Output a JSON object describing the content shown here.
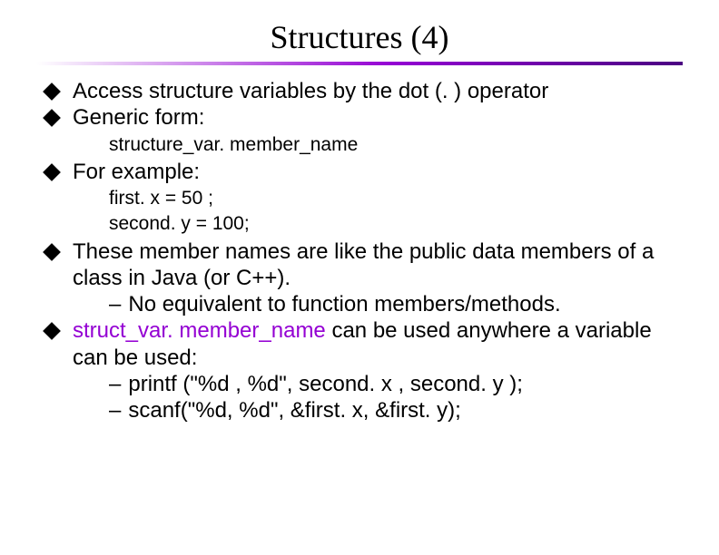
{
  "title": "Structures (4)",
  "bullets": {
    "b1": "Access structure variables by the dot (. ) operator",
    "b2": "Generic form:",
    "sub1": "structure_var. member_name",
    "b3": "For example:",
    "sub2a": "first. x = 50 ;",
    "sub2b": "second. y = 100;",
    "b4a": "These member names are like the public data members of a class in Java (or C++).",
    "b4_dash": "No equivalent to function members/methods.",
    "b5_code": "struct_var. member_name",
    "b5_rest": " can be used anywhere a variable can be used:",
    "b5_dash1": "printf (\"%d , %d\", second. x , second. y );",
    "b5_dash2": "scanf(\"%d, %d\", &first. x, &first. y);"
  }
}
